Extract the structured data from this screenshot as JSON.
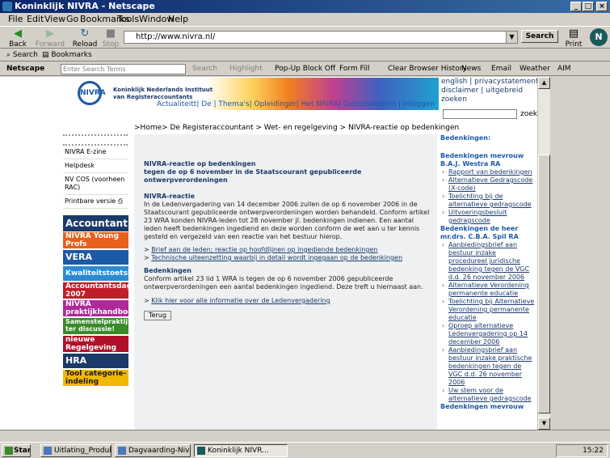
{
  "window": {
    "title": "Koninklijk NIVRA - Netscape"
  },
  "menu": [
    "File",
    "Edit",
    "View",
    "Go",
    "Bookmarks",
    "Tools",
    "Window",
    "Help"
  ],
  "nav": {
    "back": "Back",
    "forward": "Forward",
    "reload": "Reload",
    "stop": "Stop",
    "url": "http://www.nivra.nl/",
    "search": "Search",
    "print": "Print"
  },
  "personal": {
    "search": "Search",
    "bookmarks": "Bookmarks"
  },
  "nstoolbar": {
    "netscape": "Netscape",
    "placeholder": "Enter Search Terms",
    "search": "Search",
    "highlight": "Highlight",
    "popup": "Pop-Up Block Off",
    "formfill": "Form Fill",
    "clear": "Clear Browser History",
    "news": "News",
    "email": "Email",
    "weather": "Weather",
    "aim": "AIM"
  },
  "site": {
    "logo": "NIVRA",
    "org_line1": "Koninklijk Nederlands Instituut",
    "org_line2": "van Registeraccountants",
    "topnav": "Actualiteitt| De                    | Thema's| Opleidinger| Het NIVRA| Dienstverlenin | Inloggen",
    "toplinks": "english | privacystatement | disclaimer | uitgebreid zoeken",
    "zoek": "zoek",
    "crumbs": ">Home> De Registeraccountant > Wet- en regelgeving > NIVRA-reactie op bedenkingen",
    "leftmenu": [
      "NIVRA E-zine",
      "Helpdesk",
      "NV COS (voorheen RAC)",
      "Printbare versie"
    ],
    "banners": [
      {
        "text": "Accountant.nl",
        "bg": "#1b3a6a"
      },
      {
        "text": "NIVRA Young Profs",
        "bg": "#e8601c"
      },
      {
        "text": "VERA",
        "bg": "#1b5aa6"
      },
      {
        "text": "Kwaliteitstoetsing",
        "bg": "#2a8ad4"
      },
      {
        "text": "Accountantsdag 2007",
        "bg": "#c01e28"
      },
      {
        "text": "NIVRA praktijkhandboeken",
        "bg": "#b0289a"
      },
      {
        "text": "Samenstelpraktijk ter discussie!",
        "bg": "#3a8a2a"
      },
      {
        "text": "nieuwe Regelgeving 2007",
        "bg": "#b0102a"
      },
      {
        "text": "HRA",
        "bg": "#1b3a6a"
      },
      {
        "text": "Tool categorie-indeling",
        "bg": "#f0b800"
      }
    ],
    "main": {
      "title": "NIVRA-reactie op bedenkingen\ntegen de op 6 november in de Staatscourant gepubliceerde ontwerpverordeningen",
      "h1": "NIVRA-reactie",
      "p1": "In de Ledenvergadering van 14 december 2006 zullen de op 6 november 2006 in de Staatscourant gepubliceerde ontwerpverordeningen worden behandeld. Conform artikel 23 WRA konden NIVRA-leden tot 28 november jl. bedenkingen indienen. Een aantal leden heeft bedenkingen ingediend en deze worden conform de wet aan u ter kennis gesteld en vergezeld van een reactie van het bestuur hierop.",
      "link1": "Brief aan de leden; reactie op hoofdlijnen op ingediende bedenkingen",
      "link2": "Technische uiteenzetting waarbij in detail wordt ingegaan op de bedenkingen",
      "h2": "Bedenkingen",
      "p2": "Conform artikel 23 lid 1 WRA is tegen de op 6 november 2006 gepubliceerde ontwerpverordeningen een aantal bedenkingen ingediend. Deze treft u hiernaast aan.",
      "link3": "Klik hier voor alle informatie over de Ledenvergadering",
      "terug": "Terug"
    },
    "right": {
      "heading": "Bedenkingen:",
      "g1": "Bedenkingen mevrouw B.A.J. Westra RA",
      "g1items": [
        "Rapport van bedenkingen",
        "Alternatieve Gedragscode (X-code)",
        "Toelichting bij de alternatieve gedragscode",
        "Uitvoeringsbesluit gedragscode"
      ],
      "g2": "Bedenkingen de heer mr.drs. C.B.A. Spil RA",
      "g2items": [
        "Aanbiedingsbrief aan bestuur inzake procedureel juridische bedenking tegen de VGC d.d. 26 november 2006",
        "Alternatieve Verordening permanente educatie",
        "Toelichting bij Alternatieve Verordening permanente educatie",
        "Oproep alternatieve Ledenvergadering op 14 december 2006",
        "Aanbiedingsbrief aan bestuur inzake praktische bedenkingen tegen de VGC d.d. 26 november 2006",
        "Uw stem voor de alternatieve gedragscode"
      ],
      "g3": "Bedenkingen mevrouw"
    }
  },
  "taskbar": {
    "start": "Start",
    "tasks": [
      "Uitlating_Produktie...",
      "Dagvaarding-Nivra...",
      "Koninklijk NIVR..."
    ],
    "clock": "15:22"
  }
}
